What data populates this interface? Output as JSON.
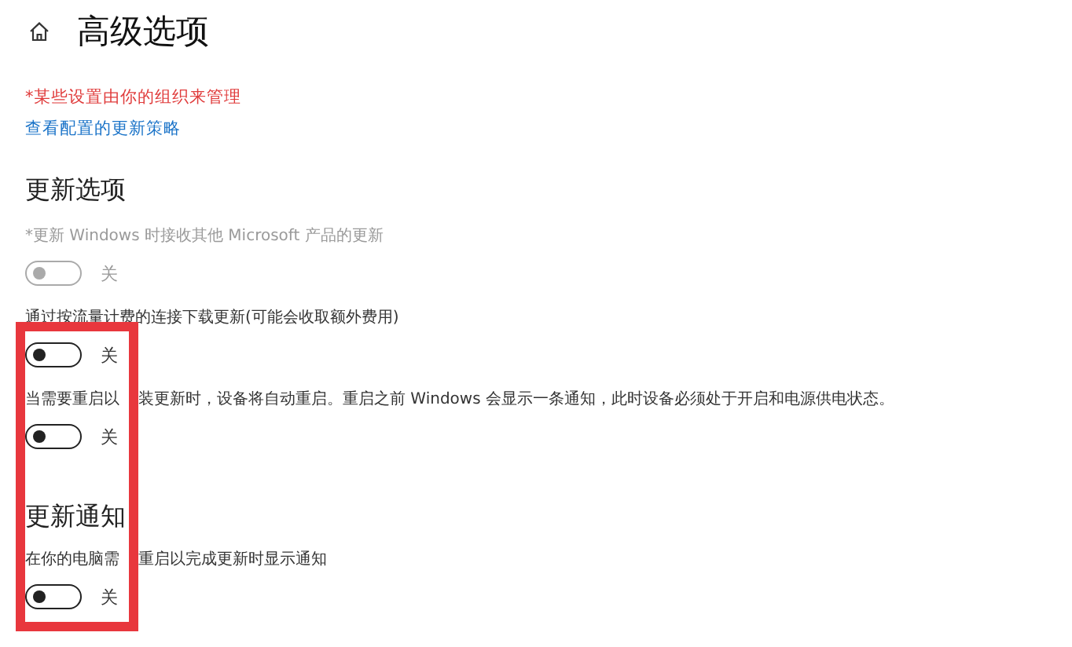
{
  "page": {
    "title": "高级选项"
  },
  "managed_notice": "*某些设置由你的组织来管理",
  "policy_link": "查看配置的更新策略",
  "sections": [
    {
      "heading": "更新选项",
      "options": [
        {
          "label_parts": [
            "*更新 Windows 时接收其他 Microsoft 产品的更新"
          ],
          "on": false,
          "disabled": true,
          "state_text": "关"
        },
        {
          "label_parts": [
            "通过按流量计费的连接下载更新(可能会收取额外费用)"
          ],
          "on": false,
          "disabled": false,
          "state_text": "关"
        },
        {
          "label_parts": [
            "当需要重启以",
            "装更新时，设备将自动重启。重启之前 Windows 会显示一条通知，此时设备必须处于开启和电源供电状态。"
          ],
          "on": false,
          "disabled": false,
          "state_text": "关"
        }
      ]
    },
    {
      "heading": "更新通知",
      "options": [
        {
          "label_parts": [
            "在你的电脑需",
            "重启以完成更新时显示通知"
          ],
          "on": false,
          "disabled": false,
          "state_text": "关"
        }
      ]
    }
  ],
  "annotation": {
    "kind": "highlight-frame",
    "color": "#e8373d"
  }
}
